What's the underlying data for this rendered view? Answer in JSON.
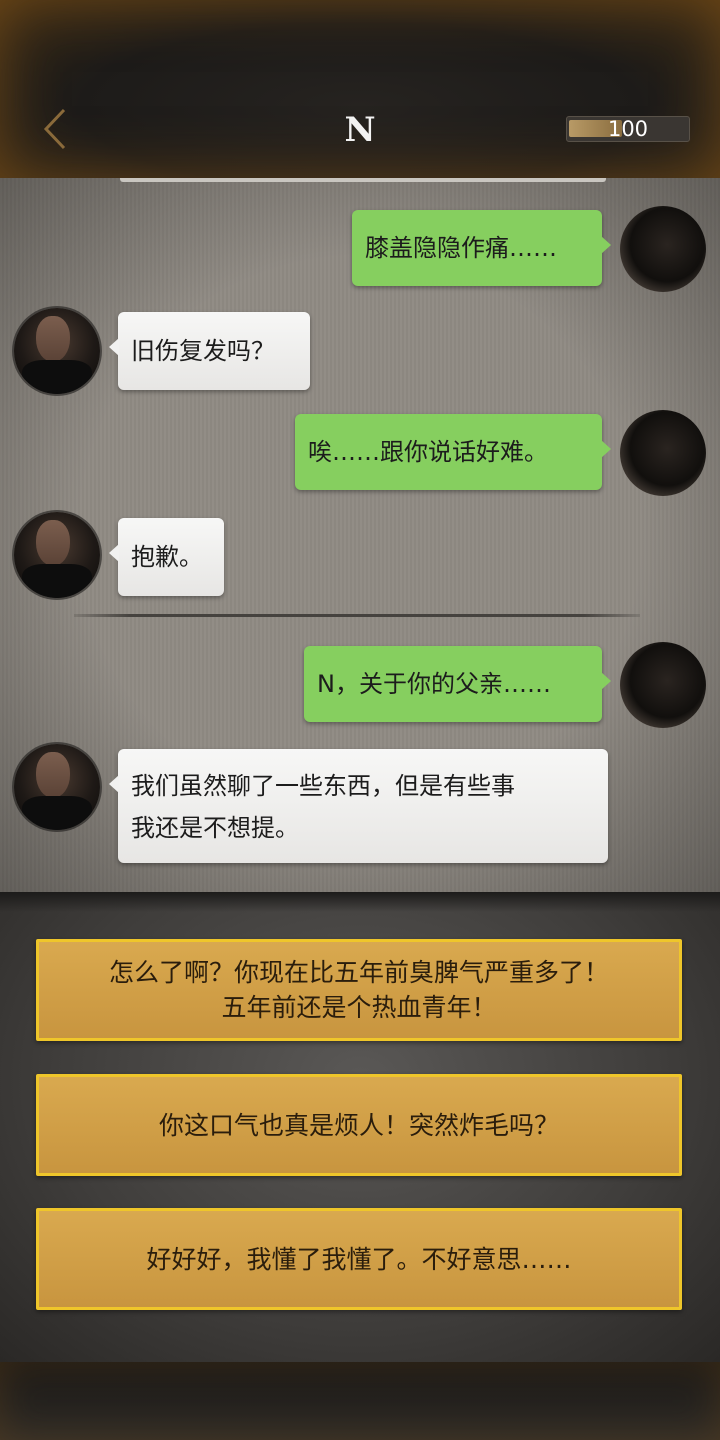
{
  "header": {
    "title": "N",
    "energy_value": "100",
    "energy_fraction": 0.45
  },
  "messages": [
    {
      "from": "self",
      "text": "膝盖隐隐作痛……"
    },
    {
      "from": "N",
      "text": "旧伤复发吗？"
    },
    {
      "from": "self",
      "text": "唉……跟你说话好难。"
    },
    {
      "from": "N",
      "text": "抱歉。"
    },
    {
      "from": "self",
      "text": "N，关于你的父亲……"
    },
    {
      "from": "N",
      "text_line1": "我们虽然聊了一些东西，但是有些事",
      "text_line2": "我还是不想提。"
    }
  ],
  "options": [
    {
      "line1": "怎么了啊？你现在比五年前臭脾气严重多了！",
      "line2": "五年前还是个热血青年！"
    },
    {
      "line1": "你这口气也真是烦人！突然炸毛吗？"
    },
    {
      "line1": "好好好，我懂了我懂了。不好意思……"
    }
  ],
  "colors": {
    "self_bubble": "#86cf5f",
    "other_bubble": "#f1f1f0",
    "option_fill": "#d0a048",
    "option_border": "#efc62a"
  },
  "icons": {
    "back": "chevron-left-icon"
  }
}
